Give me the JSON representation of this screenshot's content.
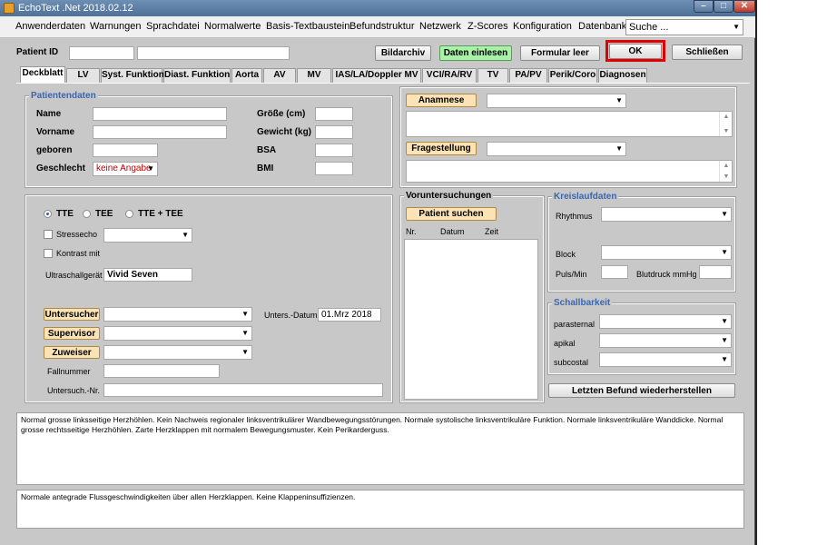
{
  "window": {
    "title": "EchoText .Net 2018.02.12"
  },
  "menu": {
    "items": [
      "Anwenderdaten",
      "Warnungen",
      "Sprachdatei",
      "Normalwerte",
      "Basis-Textbaustein",
      "Befundstruktur",
      "Netzwerk",
      "Z-Scores",
      "Konfiguration",
      "Datenbank"
    ],
    "search_placeholder": "Suche ..."
  },
  "toolbar": {
    "patient_id_label": "Patient ID",
    "patient_id_value": "",
    "bildarchiv": "Bildarchiv",
    "daten_einlesen": "Daten einlesen",
    "formular_leer": "Formular leer",
    "ok": "OK",
    "schliessen": "Schließen"
  },
  "tabs": [
    "Deckblatt",
    "LV",
    "Syst. Funktion",
    "Diast. Funktion",
    "Aorta",
    "AV",
    "MV",
    "IAS/LA/Doppler MV",
    "VCI/RA/RV",
    "TV",
    "PA/PV",
    "Perik/Coro",
    "Diagnosen"
  ],
  "patientendaten": {
    "title": "Patientendaten",
    "name_label": "Name",
    "name_value": "",
    "vorname_label": "Vorname",
    "vorname_value": "",
    "geboren_label": "geboren",
    "geboren_value": "",
    "geschlecht_label": "Geschlecht",
    "geschlecht_value": "keine Angabe",
    "groesse_label": "Größe (cm)",
    "groesse_value": "",
    "gewicht_label": "Gewicht (kg)",
    "gewicht_value": "",
    "bsa_label": "BSA",
    "bsa_value": "",
    "bmi_label": "BMI",
    "bmi_value": ""
  },
  "anamnese": {
    "button": "Anamnese",
    "select_value": "",
    "text": ""
  },
  "fragestellung": {
    "button": "Fragestellung",
    "select_value": "",
    "text": ""
  },
  "untersuchung": {
    "mode_tte": "TTE",
    "mode_tee": "TEE",
    "mode_both": "TTE + TEE",
    "stressecho_label": "Stressecho",
    "stressecho_value": "",
    "kontrast_label": "Kontrast mit",
    "geraet_label": "Ultraschallgerät",
    "geraet_value": "Vivid Seven",
    "untersucher_button": "Untersucher",
    "untersucher_value": "",
    "supervisor_button": "Supervisor",
    "supervisor_value": "",
    "zuweiser_button": "Zuweiser",
    "zuweiser_value": "",
    "datum_label": "Unters.-Datum",
    "datum_value": "01.Mrz 2018",
    "fallnummer_label": "Fallnummer",
    "fallnummer_value": "",
    "untersuch_nr_label": "Untersuch.-Nr.",
    "untersuch_nr_value": ""
  },
  "voruntersuchungen": {
    "title": "Voruntersuchungen",
    "button": "Patient suchen",
    "columns": [
      "Nr.",
      "Datum",
      "Zeit"
    ]
  },
  "kreislaufdaten": {
    "title": "Kreislaufdaten",
    "rhythmus_label": "Rhythmus",
    "rhythmus_value": "",
    "block_label": "Block",
    "block_value": "",
    "puls_label": "Puls/Min",
    "puls_value": "",
    "blutdruck_label": "Blutdruck mmHg",
    "blutdruck_value": ""
  },
  "schallbarkeit": {
    "title": "Schallbarkeit",
    "parasternal_label": "parasternal",
    "apikal_label": "apikal",
    "subcostal_label": "subcostal",
    "restore_button": "Letzten Befund wiederherstellen"
  },
  "report": {
    "text1": "Normal grosse linksseitige Herzhöhlen. Kein Nachweis regionaler linksventrikulärer Wandbewegungsstörungen. Normale systolische linksventrikuläre Funktion. Normale linksventrikuläre Wanddicke. Normal grosse rechtsseitige Herzhöhlen. Zarte Herzklappen mit normalem Bewegungsmuster. Kein Perikarderguss.",
    "text2": "Normale antegrade Flussgeschwindigkeiten über allen Herzklappen. Keine Klappeninsuffizienzen."
  },
  "colors": {
    "accent_blue": "#3a66b0",
    "highlight_red": "#e00000",
    "button_orange": "#fbe3b5",
    "button_green": "#a8f2a8"
  }
}
